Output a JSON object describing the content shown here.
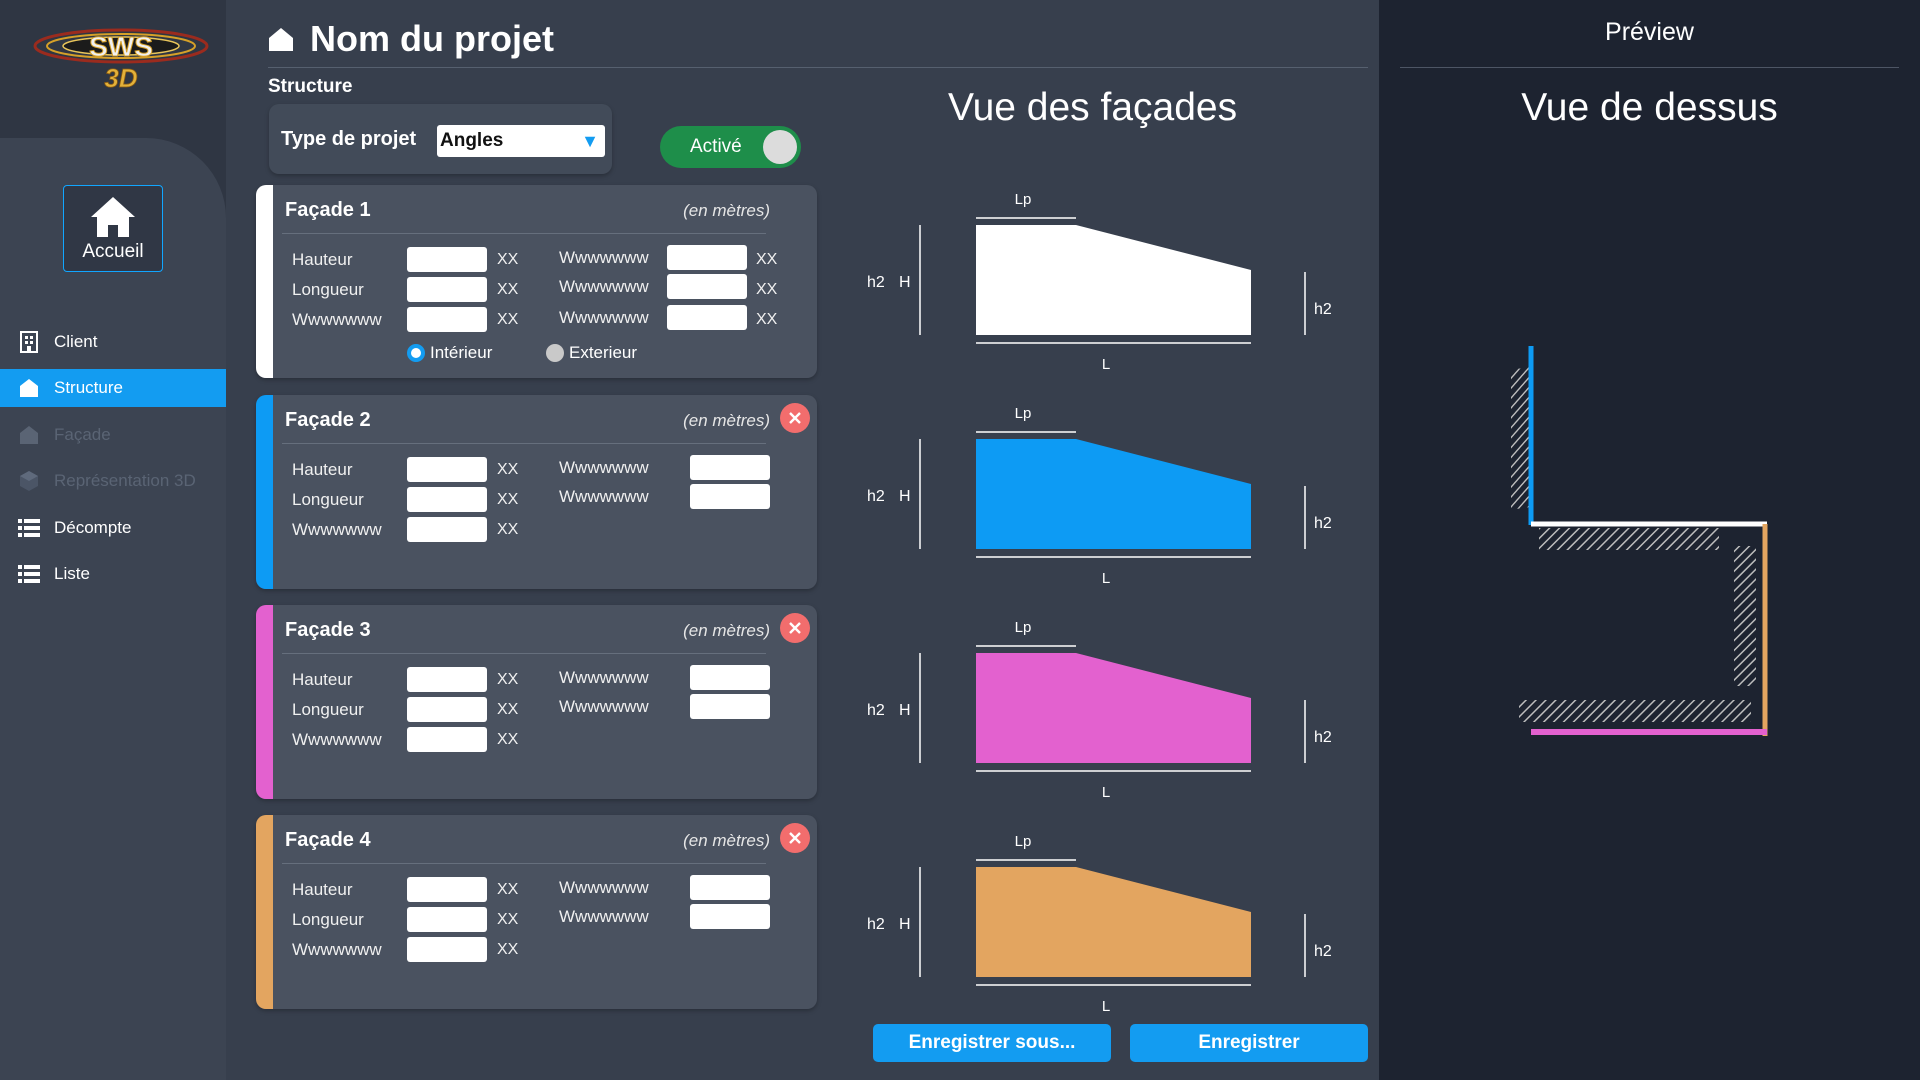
{
  "app": {
    "logo_text_top": "SWS",
    "logo_text_bottom": "3D",
    "home_label": "Accueil"
  },
  "nav": [
    {
      "label": "Client",
      "icon": "building-icon",
      "state": "normal"
    },
    {
      "label": "Structure",
      "icon": "house-icon",
      "state": "active"
    },
    {
      "label": "Façade",
      "icon": "house-icon",
      "state": "disabled"
    },
    {
      "label": "Représentation 3D",
      "icon": "cube-icon",
      "state": "disabled"
    },
    {
      "label": "Décompte",
      "icon": "list-icon",
      "state": "normal"
    },
    {
      "label": "Liste",
      "icon": "list-icon",
      "state": "normal"
    }
  ],
  "header": {
    "title": "Nom du projet",
    "section": "Structure"
  },
  "project_type": {
    "label": "Type de projet",
    "value": "Angles",
    "toggle_label": "Activé",
    "toggle_on": true
  },
  "facades": [
    {
      "title": "Façade 1",
      "unit": "(en mètres)",
      "color": "#ffffff",
      "removable": false,
      "left_fields": [
        {
          "label": "Hauteur",
          "value": "",
          "unit": "XX"
        },
        {
          "label": "Longueur",
          "value": "",
          "unit": "XX"
        },
        {
          "label": "Wwwwwww",
          "value": "",
          "unit": "XX"
        }
      ],
      "right_fields": [
        {
          "label": "Wwwwwww",
          "value": "",
          "unit": "XX"
        },
        {
          "label": "Wwwwwww",
          "value": "",
          "unit": "XX"
        },
        {
          "label": "Wwwwwww",
          "value": "",
          "unit": "XX"
        }
      ],
      "radios": [
        {
          "label": "Intérieur",
          "checked": true
        },
        {
          "label": "Exterieur",
          "checked": false
        }
      ]
    },
    {
      "title": "Façade 2",
      "unit": "(en mètres)",
      "color": "#0d9bf4",
      "removable": true,
      "left_fields": [
        {
          "label": "Hauteur",
          "value": "",
          "unit": "XX"
        },
        {
          "label": "Longueur",
          "value": "",
          "unit": "XX"
        },
        {
          "label": "Wwwwwww",
          "value": "",
          "unit": "XX"
        }
      ],
      "right_fields": [
        {
          "label": "Wwwwwww",
          "value": ""
        },
        {
          "label": "Wwwwwww",
          "value": ""
        }
      ]
    },
    {
      "title": "Façade 3",
      "unit": "(en mètres)",
      "color": "#e361cf",
      "removable": true,
      "left_fields": [
        {
          "label": "Hauteur",
          "value": "",
          "unit": "XX"
        },
        {
          "label": "Longueur",
          "value": "",
          "unit": "XX"
        },
        {
          "label": "Wwwwwww",
          "value": "",
          "unit": "XX"
        }
      ],
      "right_fields": [
        {
          "label": "Wwwwwww",
          "value": ""
        },
        {
          "label": "Wwwwwww",
          "value": ""
        }
      ]
    },
    {
      "title": "Façade 4",
      "unit": "(en mètres)",
      "color": "#e3a560",
      "removable": true,
      "left_fields": [
        {
          "label": "Hauteur",
          "value": "",
          "unit": "XX"
        },
        {
          "label": "Longueur",
          "value": "",
          "unit": "XX"
        },
        {
          "label": "Wwwwwww",
          "value": "",
          "unit": "XX"
        }
      ],
      "right_fields": [
        {
          "label": "Wwwwwww",
          "value": ""
        },
        {
          "label": "Wwwwwww",
          "value": ""
        }
      ]
    }
  ],
  "facade_view": {
    "title": "Vue des façades",
    "labels": {
      "lp": "Lp",
      "h2": "h2",
      "h": "H",
      "l": "L"
    }
  },
  "buttons": {
    "save_as": "Enregistrer sous...",
    "save": "Enregistrer"
  },
  "preview": {
    "title": "Préview",
    "subtitle": "Vue de dessus"
  }
}
